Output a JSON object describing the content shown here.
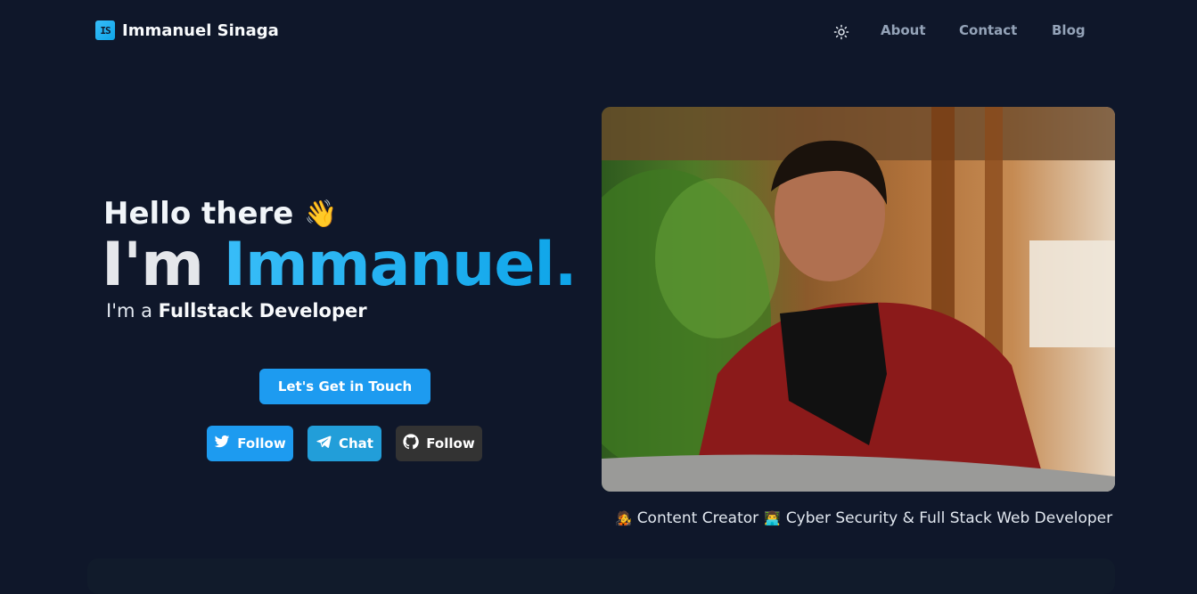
{
  "nav": {
    "brand_logo": "IS",
    "brand_name": "Immanuel Sinaga",
    "theme_icon": "sun-icon",
    "links": [
      {
        "label": "About"
      },
      {
        "label": "Contact"
      },
      {
        "label": "Blog"
      }
    ]
  },
  "hero": {
    "greeting": "Hello there",
    "wave": "👋",
    "im_prefix": "I'm ",
    "name": "Immanuel.",
    "role_prefix": "I'm a ",
    "role": "Fullstack Developer",
    "cta_label": "Let's Get in Touch",
    "social": [
      {
        "label": "Follow",
        "icon": "twitter-icon"
      },
      {
        "label": "Chat",
        "icon": "telegram-icon"
      },
      {
        "label": "Follow",
        "icon": "github-icon"
      }
    ]
  },
  "profile": {
    "caption_icon_1": "🧑‍🎤",
    "caption_part_1": "Content Creator",
    "caption_icon_2": "👨‍💻",
    "caption_part_2": "Cyber Security & Full Stack Web Developer"
  },
  "colors": {
    "background": "#0f172a",
    "accent": "#1d9bf0",
    "github": "#333333"
  }
}
